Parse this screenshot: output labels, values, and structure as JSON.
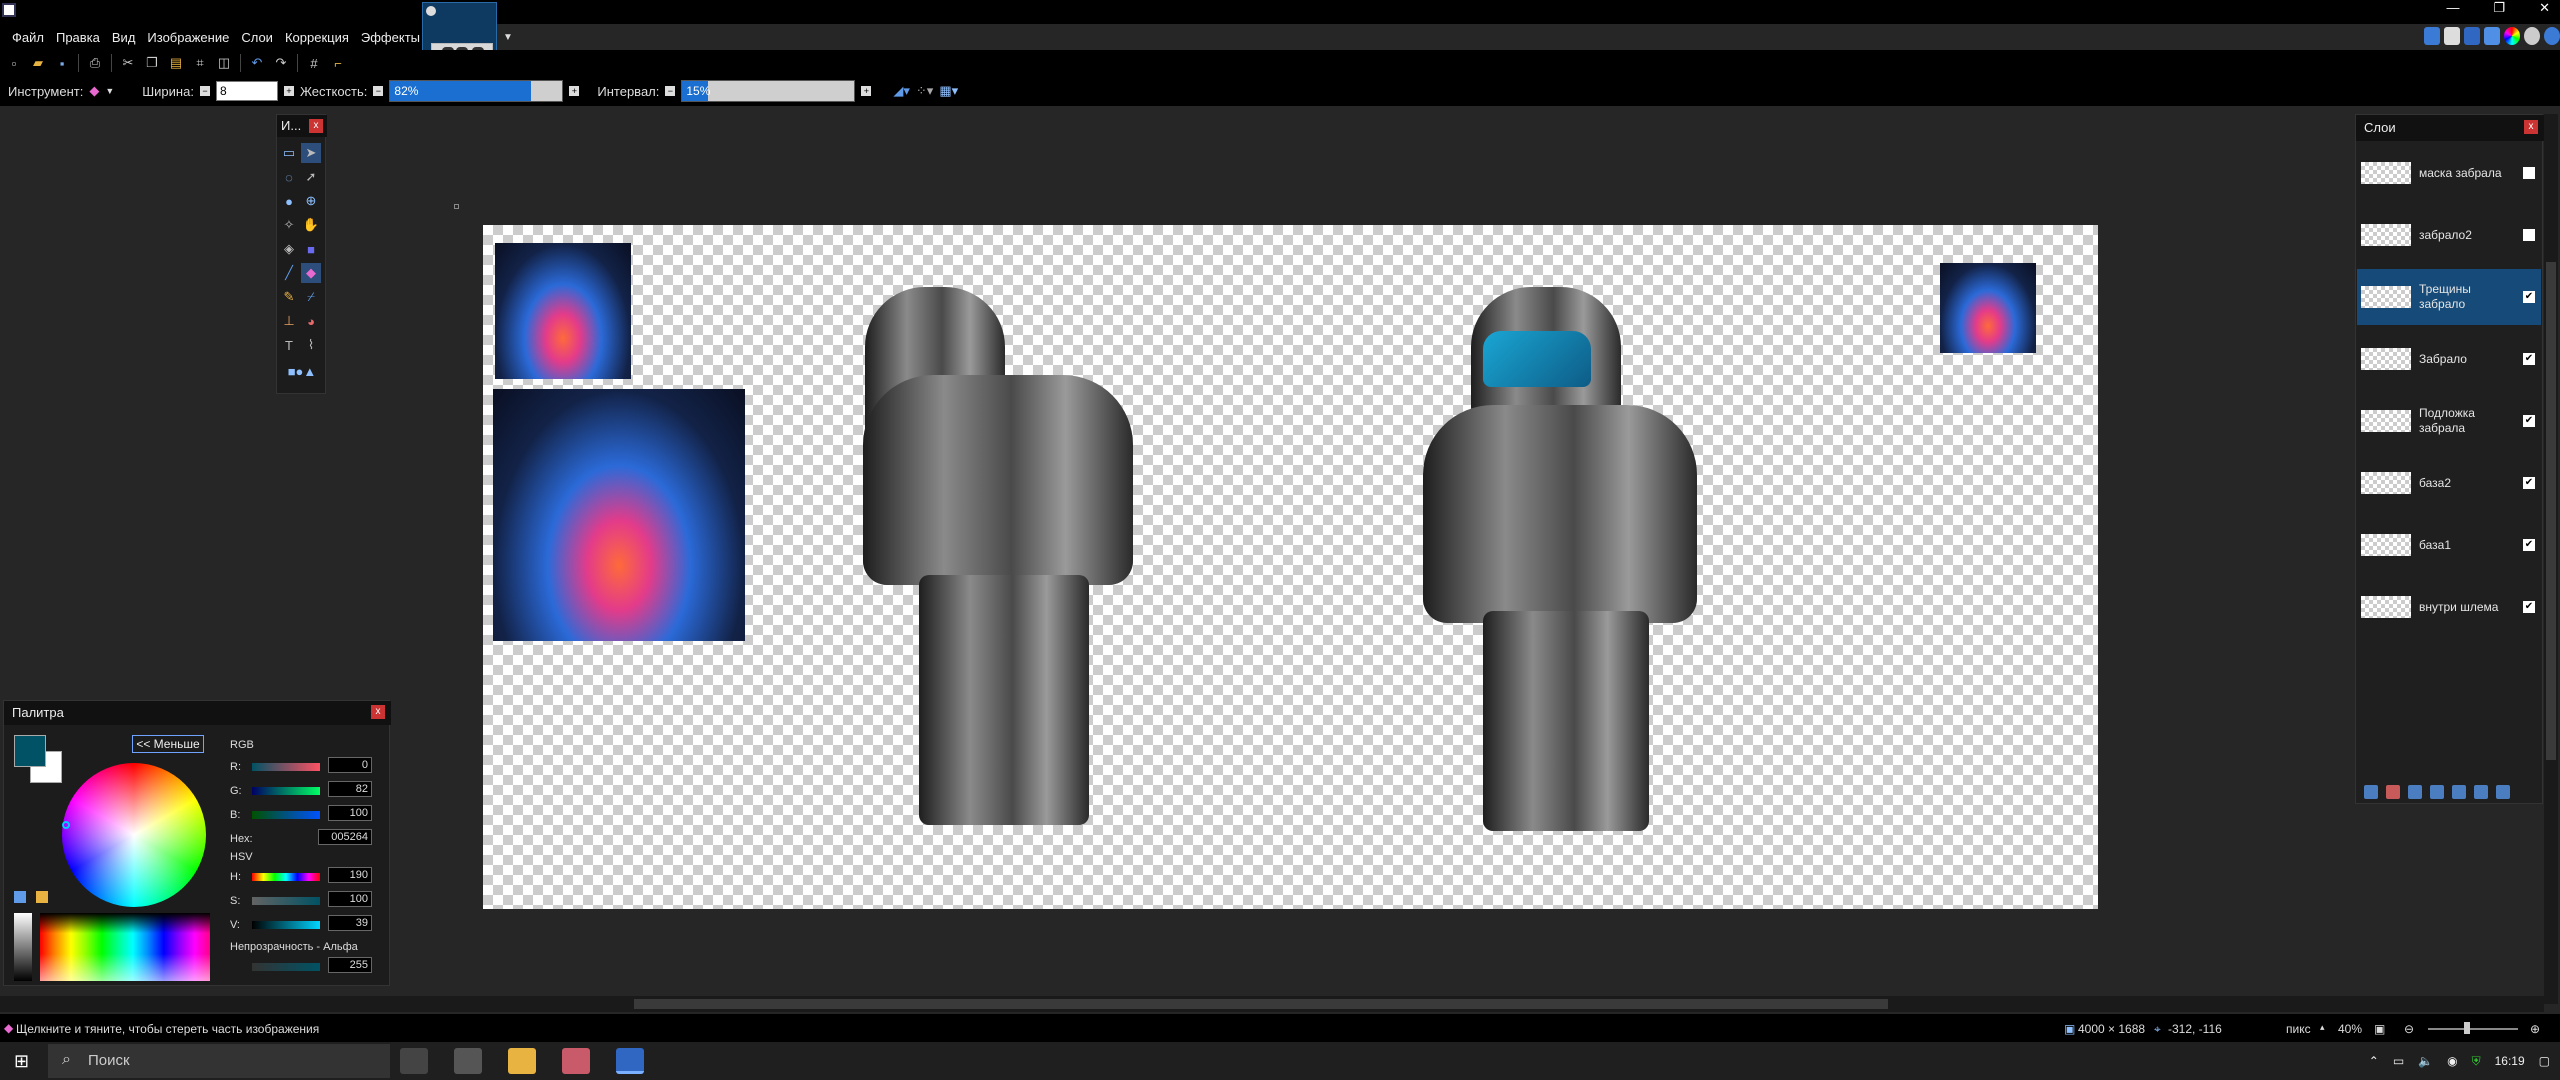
{
  "window": {
    "min": "—",
    "restore": "❐",
    "close": "✕"
  },
  "menu": [
    "Файл",
    "Правка",
    "Вид",
    "Изображение",
    "Слои",
    "Коррекция",
    "Эффекты"
  ],
  "toolbar": {
    "instrument_label": "Инструмент:",
    "width_label": "Ширина:",
    "width_value": "8",
    "hardness_label": "Жесткость:",
    "hardness_value": "82%",
    "hardness_fill": 0.82,
    "interval_label": "Интервал:",
    "interval_value": "15%",
    "interval_fill": 0.15
  },
  "tools_panel": {
    "title": "И...",
    "close": "x"
  },
  "layers_panel": {
    "title": "Слои",
    "close": "x",
    "layers": [
      {
        "name": "маска забрала",
        "checked": false,
        "selected": false
      },
      {
        "name": "забрало2",
        "checked": false,
        "selected": false
      },
      {
        "name": "Трещины забрало",
        "checked": true,
        "selected": true
      },
      {
        "name": "Забрало",
        "checked": true,
        "selected": false
      },
      {
        "name": "Подложка забрала",
        "checked": true,
        "selected": false
      },
      {
        "name": "база2",
        "checked": true,
        "selected": false
      },
      {
        "name": "база1",
        "checked": true,
        "selected": false
      },
      {
        "name": "внутри шлема",
        "checked": true,
        "selected": false
      }
    ]
  },
  "palette": {
    "title": "Палитра",
    "close": "x",
    "less_button": "<< Меньше",
    "primary_color": "#005264",
    "secondary_color": "#FFFFFF",
    "rgb_label": "RGB",
    "r_label": "R:",
    "r": "0",
    "g_label": "G:",
    "g": "82",
    "b_label": "B:",
    "b": "100",
    "hex_label": "Hex:",
    "hex": "005264",
    "hsv_label": "HSV",
    "h_label": "H:",
    "h": "190",
    "s_label": "S:",
    "s": "100",
    "v_label": "V:",
    "v": "39",
    "opacity_label": "Непрозрачность - Альфа",
    "alpha": "255"
  },
  "status": {
    "hint": "Щелкните и тяните, чтобы стереть часть изображения",
    "image_size": "4000 × 1688",
    "cursor": "-312, -116",
    "units": "пикс",
    "zoom": "40%"
  },
  "taskbar": {
    "search_placeholder": "Поиск",
    "time": "16:19"
  }
}
